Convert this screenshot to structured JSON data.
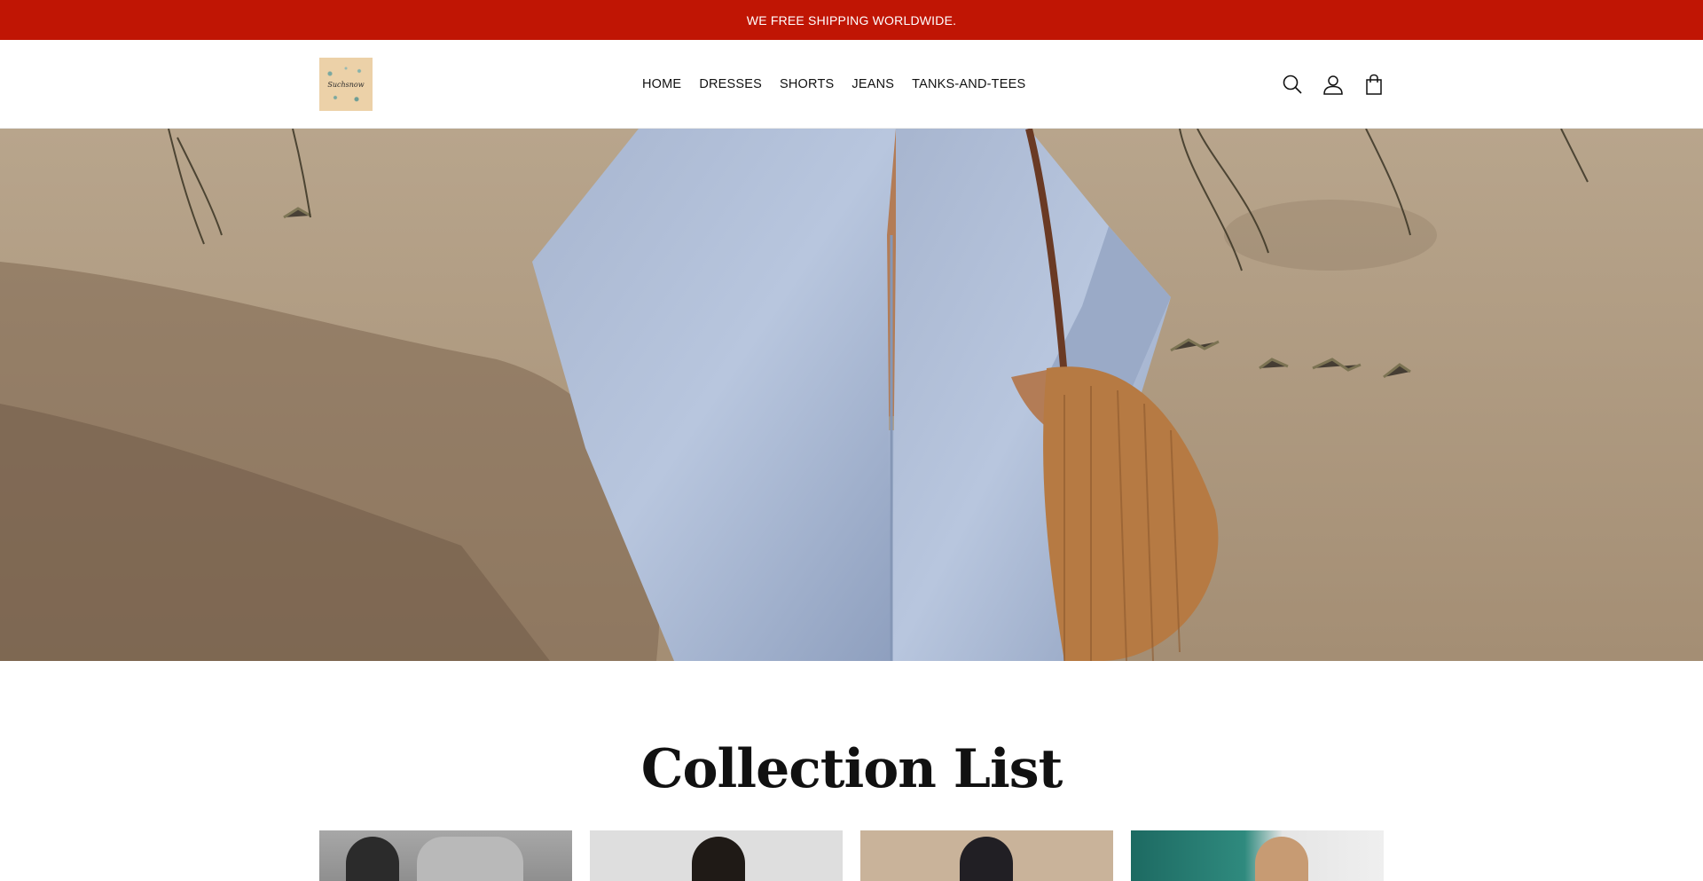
{
  "announcement": {
    "text": "WE FREE SHIPPING WORLDWIDE."
  },
  "header": {
    "logo_text": "Suchsnow",
    "nav": [
      {
        "label": "HOME"
      },
      {
        "label": "DRESSES"
      },
      {
        "label": "SHORTS"
      },
      {
        "label": "JEANS"
      },
      {
        "label": "TANKS-AND-TEES"
      }
    ],
    "icons": [
      "search-icon",
      "account-icon",
      "cart-icon"
    ]
  },
  "hero": {
    "image": "woman-in-light-blue-shirt-with-woven-basket-bag-on-beach"
  },
  "collection": {
    "title": "Collection List",
    "cards": [
      {
        "image": "grey-knit-sweater"
      },
      {
        "image": "model-light-grey-background"
      },
      {
        "image": "model-beige-background"
      },
      {
        "image": "model-on-boat-railing"
      }
    ]
  },
  "colors": {
    "announcement_bg": "#c01504",
    "text": "#111111",
    "background": "#ffffff"
  }
}
